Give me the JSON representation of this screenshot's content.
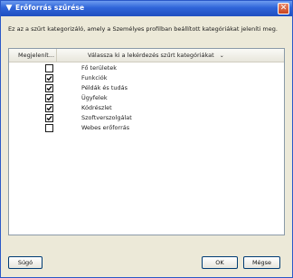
{
  "window": {
    "title": "Erőforrás szűrése",
    "description": "Ez az a szűrt kategorizáló, amely a Személyes profilban beállított kategóriákat jeleníti meg."
  },
  "list": {
    "col_display": "Megjelenít...",
    "col_category": "Válassza ki a lekérdezés szűrt kategóriákat",
    "items": [
      {
        "label": "Fő területek",
        "checked": false
      },
      {
        "label": "Funkciók",
        "checked": true
      },
      {
        "label": "Példák és tudás",
        "checked": true
      },
      {
        "label": "Ügyfelek",
        "checked": true
      },
      {
        "label": "Kódrészlet",
        "checked": true
      },
      {
        "label": "Szoftverszolgálat",
        "checked": true
      },
      {
        "label": "Webes erőforrás",
        "checked": false
      }
    ]
  },
  "buttons": {
    "help": "Súgó",
    "ok": "OK",
    "cancel": "Mégse"
  },
  "icons": {
    "title": "filter-icon",
    "close": "close-icon",
    "sort": "sort-arrow-icon",
    "check": "checkmark-icon"
  }
}
